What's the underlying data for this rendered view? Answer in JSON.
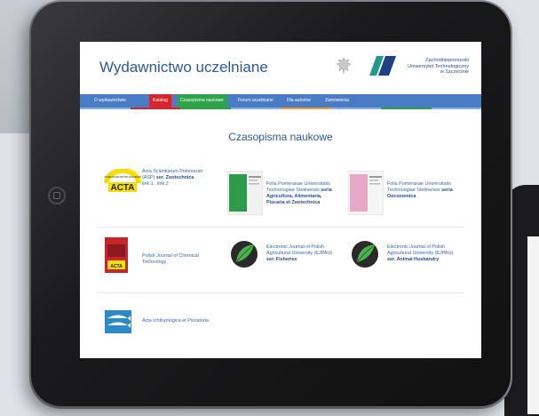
{
  "site": {
    "title": "Wydawnictwo uczelniane",
    "university": [
      "Zachodniopomorski",
      "Uniwersytet Technologiczny",
      "w Szczecinie"
    ]
  },
  "nav": {
    "items": [
      {
        "label": "O wydawnictwie",
        "color": "#4a7cc6"
      },
      {
        "label": "Katalog",
        "color": "#d8242e"
      },
      {
        "label": "Czasopisma naukowe",
        "color": "#2fa34a"
      },
      {
        "label": "Forum uczelniane",
        "color": "#4a7cc6"
      },
      {
        "label": "Dla autorów",
        "color": "#4a7cc6"
      },
      {
        "label": "Zamówienia",
        "color": "#4a7cc6"
      }
    ]
  },
  "main": {
    "section_title": "Czasopisma naukowe",
    "journals": [
      {
        "line1": "Acta Scientiarum Polonorum",
        "line2": "(ASP)",
        "line2_bold": "ser. Zootechnica",
        "links": "link 1 , link 2",
        "logo_text": "ACTA",
        "arc_text": "SCIENTIARUM POLONORUM"
      },
      {
        "lines": [
          "Folia Pomeranae Universitatis",
          "Technologiae Stetinensis"
        ],
        "bold_inline": "seria",
        "bold_lines": [
          "Agricultura, Alimentaria,",
          "Piscaria et Zootechnica"
        ]
      },
      {
        "lines": [
          "Folia Pomeranae Universitatis",
          "Technologiae Stetinensis"
        ],
        "bold_inline": "seria",
        "bold_lines": [
          "Oeconomica"
        ]
      },
      {
        "lines": [
          "Polish Journal of Chemical",
          "Technology"
        ],
        "cover_text": "ACTA"
      },
      {
        "lines": [
          "Electronic Journal of Polish",
          "Agricultural University (EJPAU)"
        ],
        "bold_lines": [
          "ser. Fisheries"
        ]
      },
      {
        "lines": [
          "Electronic Journal of Polish",
          "Agricultural University (EJPAU)"
        ],
        "bold_lines": [
          "ser. Animal Husbandry"
        ]
      },
      {
        "lines": [
          "Acta Ichthyologica et Piscatoria"
        ]
      }
    ]
  },
  "colors": {
    "brand_blue": "#2a5aa0",
    "nav_blue": "#4a7cc6",
    "red": "#d8242e",
    "green": "#2fa34a"
  }
}
